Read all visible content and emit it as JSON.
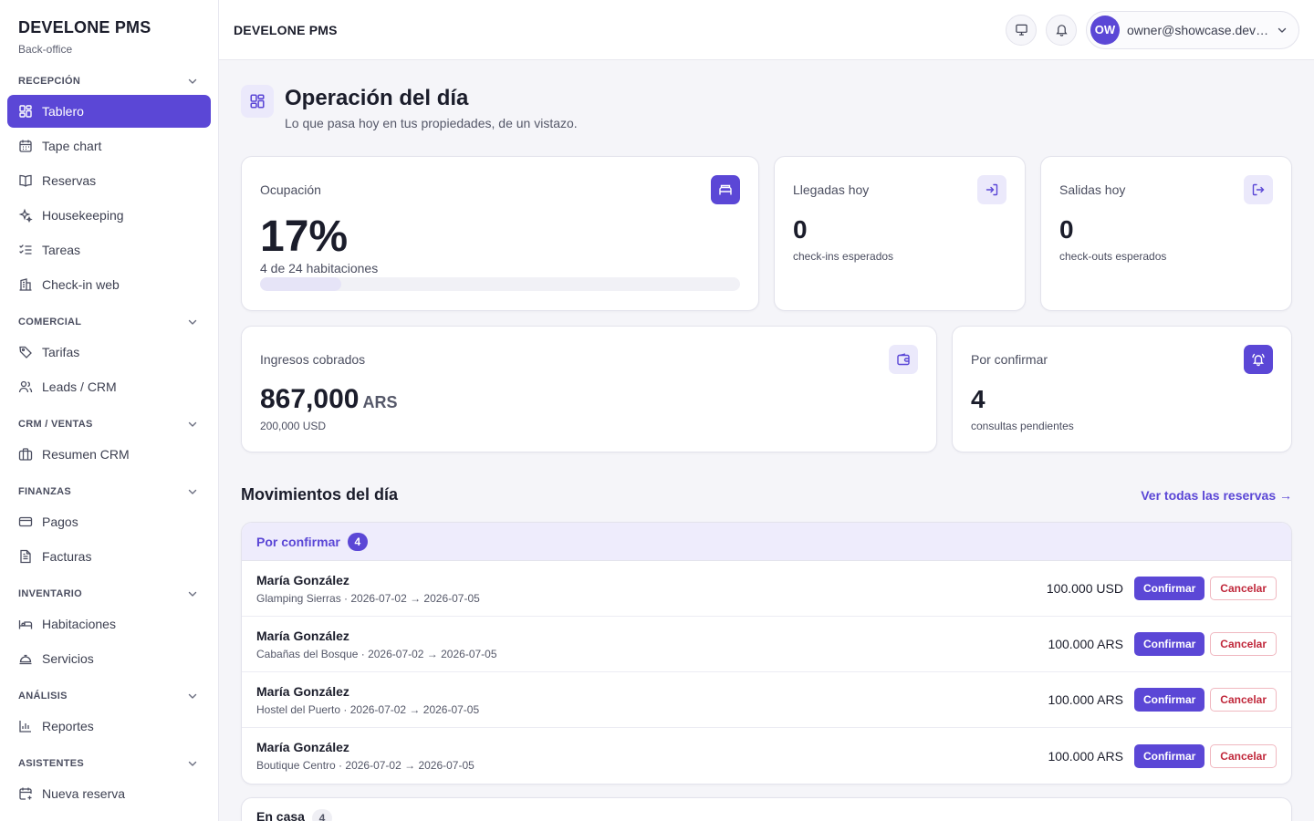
{
  "brand": {
    "title": "DEVELONE PMS",
    "subtitle": "Back-office"
  },
  "sidebar": {
    "sections": [
      {
        "label": "RECEPCIÓN",
        "items": [
          {
            "label": "Tablero",
            "icon": "dashboard-icon",
            "active": true
          },
          {
            "label": "Tape chart",
            "icon": "calendar-icon"
          },
          {
            "label": "Reservas",
            "icon": "book-icon"
          },
          {
            "label": "Housekeeping",
            "icon": "sparkles-icon"
          },
          {
            "label": "Tareas",
            "icon": "checklist-icon"
          },
          {
            "label": "Check-in web",
            "icon": "building-icon"
          }
        ]
      },
      {
        "label": "COMERCIAL",
        "items": [
          {
            "label": "Tarifas",
            "icon": "tag-icon"
          },
          {
            "label": "Leads / CRM",
            "icon": "users-icon"
          }
        ]
      },
      {
        "label": "CRM / VENTAS",
        "items": [
          {
            "label": "Resumen CRM",
            "icon": "briefcase-icon"
          }
        ]
      },
      {
        "label": "FINANZAS",
        "items": [
          {
            "label": "Pagos",
            "icon": "credit-card-icon"
          },
          {
            "label": "Facturas",
            "icon": "file-text-icon"
          }
        ]
      },
      {
        "label": "INVENTARIO",
        "items": [
          {
            "label": "Habitaciones",
            "icon": "bed-icon"
          },
          {
            "label": "Servicios",
            "icon": "bell-service-icon"
          }
        ]
      },
      {
        "label": "ANÁLISIS",
        "items": [
          {
            "label": "Reportes",
            "icon": "bar-chart-icon"
          }
        ]
      },
      {
        "label": "ASISTENTES",
        "items": [
          {
            "label": "Nueva reserva",
            "icon": "calendar-plus-icon"
          }
        ]
      }
    ]
  },
  "topbar": {
    "title": "DEVELONE PMS",
    "user_initials": "OW",
    "user_email": "owner@showcase.develone.com"
  },
  "page": {
    "title": "Operación del día",
    "subtitle": "Lo que pasa hoy en tus propiedades, de un vistazo."
  },
  "stats": {
    "occupancy": {
      "label": "Ocupación",
      "value": "17%",
      "detail": "4 de 24 habitaciones",
      "fraction": 0.17
    },
    "arrivals": {
      "label": "Llegadas hoy",
      "value": "0",
      "detail": "check-ins esperados"
    },
    "departures": {
      "label": "Salidas hoy",
      "value": "0",
      "detail": "check-outs esperados"
    },
    "revenue": {
      "label": "Ingresos cobrados",
      "value": "867,000",
      "unit": "ARS",
      "detail": "200,000 USD"
    },
    "pending": {
      "label": "Por confirmar",
      "value": "4",
      "detail": "consultas pendientes"
    }
  },
  "movements": {
    "title": "Movimientos del día",
    "link": "Ver todas las reservas →",
    "pending_group": {
      "label": "Por confirmar",
      "count": "4",
      "confirm_label": "Confirmar",
      "cancel_label": "Cancelar",
      "rows": [
        {
          "guest": "María González",
          "stay": "Glamping Sierras · 2026-07-02 → 2026-07-05",
          "amount": "100.000 USD"
        },
        {
          "guest": "María González",
          "stay": "Cabañas del Bosque · 2026-07-02 → 2026-07-05",
          "amount": "100.000 ARS"
        },
        {
          "guest": "María González",
          "stay": "Hostel del Puerto · 2026-07-02 → 2026-07-05",
          "amount": "100.000 ARS"
        },
        {
          "guest": "María González",
          "stay": "Boutique Centro · 2026-07-02 → 2026-07-05",
          "amount": "100.000 ARS"
        }
      ]
    },
    "inhouse_group": {
      "label": "En casa",
      "count": "4"
    }
  },
  "colors": {
    "accent": "#5b47d6",
    "accent_soft": "#ebe9fb",
    "danger": "#c0283b"
  }
}
